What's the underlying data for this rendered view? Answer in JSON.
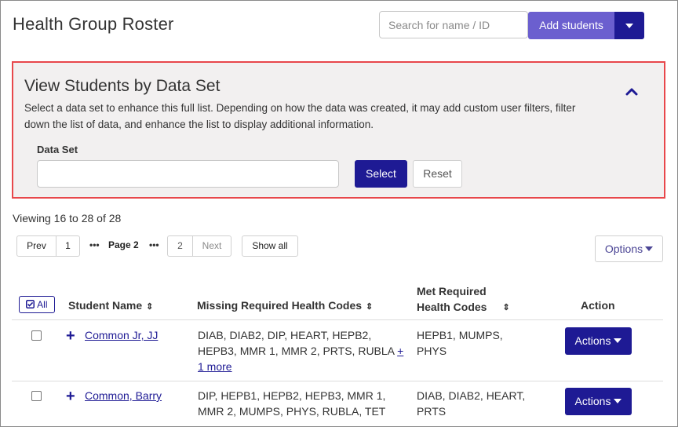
{
  "header": {
    "title": "Health Group Roster",
    "search_placeholder": "Search for name / ID",
    "add_students_label": "Add students"
  },
  "dataset_panel": {
    "title": "View Students by Data Set",
    "description": "Select a data set to enhance this full list. Depending on how the data was created, it may add custom user filters, filter down the list of data, and enhance the list to display additional information.",
    "field_label": "Data Set",
    "field_value": "",
    "select_label": "Select",
    "reset_label": "Reset"
  },
  "listing": {
    "viewing_text": "Viewing 16 to 28 of 28"
  },
  "pagination": {
    "prev": "Prev",
    "page1": "1",
    "dots1": "•••",
    "current": "Page 2",
    "dots2": "•••",
    "page2": "2",
    "next": "Next",
    "show_all": "Show all"
  },
  "options_label": "Options",
  "table": {
    "all_label": "All",
    "headers": {
      "student_name": "Student Name",
      "missing": "Missing Required Health Codes",
      "met_line1": "Met Required",
      "met_line2": "Health Codes",
      "action": "Action"
    },
    "rows": [
      {
        "name": "Common Jr, JJ",
        "missing_line1": "DIAB, DIAB2, DIP, HEART, HEPB2,",
        "missing_line2": "HEPB3, MMR 1, MMR 2, PRTS, RUBLA",
        "missing_more_plus": "+",
        "missing_more": "1 more",
        "met_line1": "HEPB1, MUMPS,",
        "met_line2": "PHYS",
        "actions_label": "Actions"
      },
      {
        "name": "Common, Barry",
        "missing_line1": "DIP, HEPB1, HEPB2, HEPB3, MMR 1,",
        "missing_line2": "MMR 2, MUMPS, PHYS, RUBLA, TET",
        "met_line1": "DIAB, DIAB2, HEART,",
        "met_line2": "PRTS",
        "actions_label": "Actions"
      }
    ]
  },
  "colors": {
    "accent": "#1e1a94",
    "accent_light": "#6b5fcf",
    "panel_border": "#e8474b",
    "panel_bg": "#f2f0f0"
  }
}
